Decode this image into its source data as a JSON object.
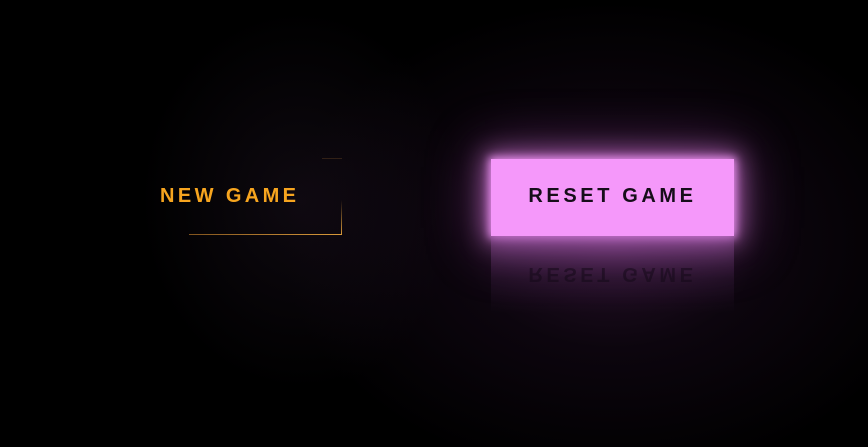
{
  "buttons": {
    "new_game": {
      "label": "NEW GAME",
      "color": "#f7a51f"
    },
    "reset_game": {
      "label": "RESET GAME",
      "background": "#f598fa",
      "text_color": "#160d1a"
    }
  },
  "theme": {
    "background": "#000000",
    "glow": "#f598fa"
  }
}
